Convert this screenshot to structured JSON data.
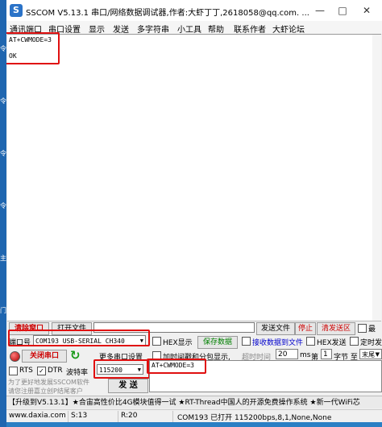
{
  "title_bar": {
    "app_icon_glyph": "S",
    "title": "SSCOM V5.13.1 串口/网络数据调试器,作者:大虾丁丁,2618058@qq.com. ..."
  },
  "menu": [
    "通讯端口",
    "串口设置",
    "显示",
    "发送",
    "多字符串",
    "小工具",
    "帮助",
    "联系作者",
    "大虾论坛"
  ],
  "receive": {
    "lines": [
      "AT+CWMODE=3",
      "",
      "OK"
    ]
  },
  "toolbar": {
    "clear_window": "清除窗口",
    "open_file": "打开文件",
    "send_file": "发送文件",
    "stop": "停止",
    "clear_send": "清发送区",
    "last": "最"
  },
  "port": {
    "port_label": "端口号",
    "port_value": "COM193 USB-SERIAL CH340",
    "close_button": "关闭串口",
    "more_settings": "更多串口设置",
    "rts": "RTS",
    "dtr": "DTR",
    "baud_label": "波特率",
    "baud_value": "115200",
    "send_button": "发 送"
  },
  "options": {
    "hex_display": "HEX显示",
    "save_data": "保存数据",
    "receive_to_file": "接收数据到文件",
    "hex_send": "HEX发送",
    "timed_send": "定时发",
    "timestamp": "加时间戳和分包显示,",
    "timeout_label": "超时时间",
    "timeout_value": "20",
    "ms_label": "ms",
    "nth_label": "第",
    "nth_value": "1",
    "byte_label": "字节 至",
    "end_value": "末尾"
  },
  "send": {
    "text": "AT+CWMODE=3"
  },
  "promo": {
    "line1": "为了更好地发展SSCOM软件",
    "line2": "请您注册嘉立创P结尾客户"
  },
  "ad_bar": "【升级到V5.13.1】★合宙高性价比4G模块值得一试 ★RT-Thread中国人的开源免费操作系统 ★新一代WiFi芯",
  "status": {
    "website": "www.daxia.com",
    "s": "S:13",
    "r": "R:20",
    "port_status": "COM193 已打开  115200bps,8,1,None,None"
  },
  "desktop_side_labels": [
    "令",
    "令",
    "令",
    "令",
    "主",
    "门"
  ],
  "colors": {
    "highlight": "#e01010",
    "link_blue": "#0000cc",
    "save_green": "#008000",
    "close_red": "#cc0000"
  }
}
